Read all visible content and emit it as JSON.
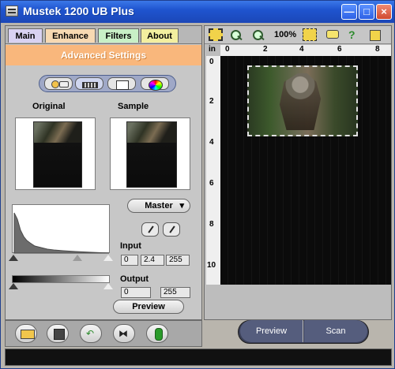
{
  "window": {
    "title": "Mustek 1200 UB Plus",
    "controls": [
      "minimize-icon",
      "maximize-icon",
      "close-icon"
    ]
  },
  "tabs": [
    "Main",
    "Enhance",
    "Filters",
    "About"
  ],
  "advanced": "Advanced Settings",
  "mode_buttons": [
    "brightness-contrast-icon",
    "histogram-icon",
    "curve-icon",
    "color-wheel-icon"
  ],
  "previews": {
    "original_label": "Original",
    "sample_label": "Sample"
  },
  "channel": {
    "selected": "Master"
  },
  "input": {
    "label": "Input",
    "values": [
      "0",
      "2.4",
      "255"
    ]
  },
  "output": {
    "label": "Output",
    "values": [
      "0",
      "255"
    ]
  },
  "buttons": {
    "preview_small": "Preview",
    "preview": "Preview",
    "scan": "Scan"
  },
  "toolbar": {
    "zoom": "100%"
  },
  "ruler": {
    "unit": "in",
    "top": [
      "0",
      "2",
      "4",
      "6",
      "8"
    ],
    "left": [
      "0",
      "2",
      "4",
      "6",
      "8",
      "10"
    ]
  }
}
